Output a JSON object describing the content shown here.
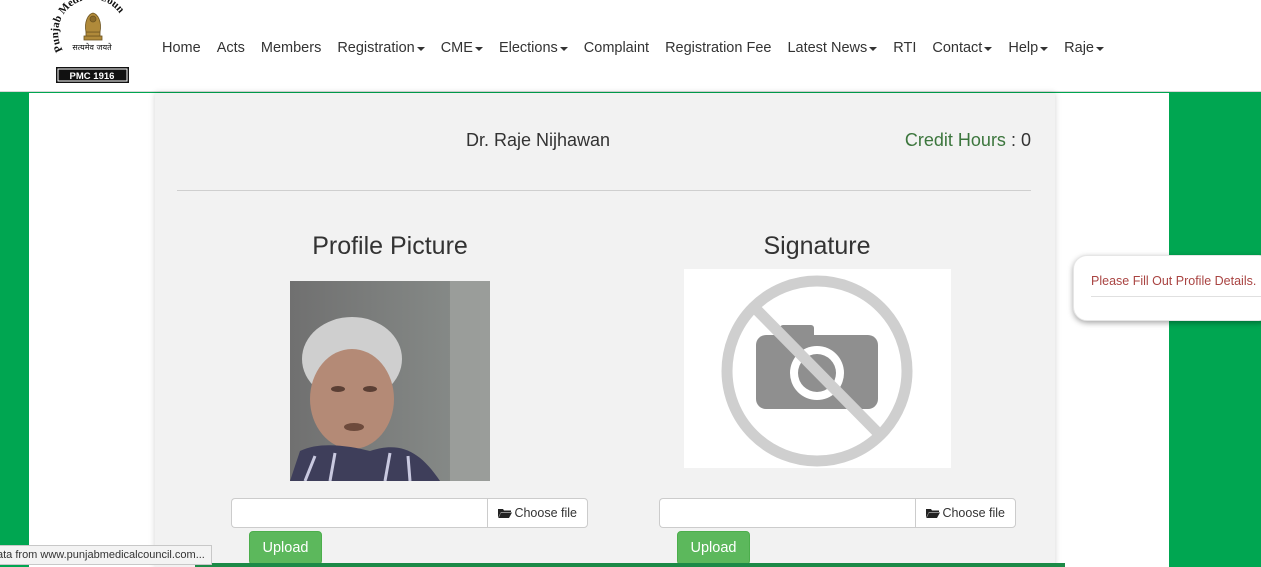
{
  "header": {
    "logo": {
      "name": "Punjab Medical Council",
      "motto": "सत्यमेव जयते",
      "code": "PMC 1916"
    },
    "nav": [
      {
        "label": "Home",
        "dropdown": false
      },
      {
        "label": "Acts",
        "dropdown": false
      },
      {
        "label": "Members",
        "dropdown": false
      },
      {
        "label": "Registration",
        "dropdown": true
      },
      {
        "label": "CME",
        "dropdown": true
      },
      {
        "label": "Elections",
        "dropdown": true
      },
      {
        "label": "Complaint",
        "dropdown": false
      },
      {
        "label": "Registration Fee",
        "dropdown": false
      },
      {
        "label": "Latest News",
        "dropdown": true
      },
      {
        "label": "RTI",
        "dropdown": false
      },
      {
        "label": "Contact",
        "dropdown": true
      },
      {
        "label": "Help",
        "dropdown": true
      },
      {
        "label": "Raje",
        "dropdown": true
      }
    ]
  },
  "profile": {
    "doctor_name": "Dr. Raje Nijhawan",
    "credit_label": "Credit Hours",
    "credit_sep": ":",
    "credit_value": "0"
  },
  "picture_section": {
    "title": "Profile Picture",
    "file_value": "",
    "choose_label": "Choose file",
    "upload_label": "Upload"
  },
  "signature_section": {
    "title": "Signature",
    "file_value": "",
    "choose_label": "Choose file",
    "upload_label": "Upload",
    "placeholder_icon": "no-camera-icon"
  },
  "toast": {
    "message": "Please Fill Out Profile Details."
  },
  "status_bar": {
    "text": "ata from www.punjabmedicalcouncil.com..."
  },
  "colors": {
    "brand_green": "#00a651",
    "upload_green": "#5cb85c",
    "credit_green": "#3c763d",
    "toast_text": "#a94442"
  }
}
